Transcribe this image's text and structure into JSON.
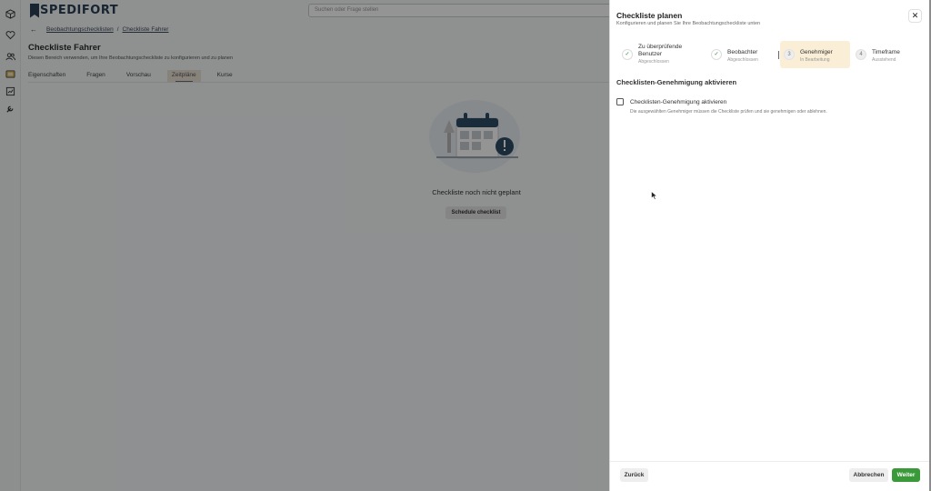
{
  "brand": {
    "name": "SPEDIFORT"
  },
  "search": {
    "placeholder": "Suchen oder Frage stellen"
  },
  "rail": {
    "icons": [
      "cube-icon",
      "heart-icon",
      "users-icon",
      "folder-icon",
      "chart-icon",
      "wrench-icon"
    ]
  },
  "breadcrumb": {
    "parent": "Beobachtungschecklisten",
    "separator": "/",
    "current": "Checkliste Fahrer"
  },
  "page": {
    "title": "Checkliste Fahrer",
    "subtitle": "Diesen Bereich verwenden, um Ihre Beobachtungscheckliste zu konfigurieren und zu planen"
  },
  "tabs": [
    {
      "label": "Eigenschaften",
      "active": false
    },
    {
      "label": "Fragen",
      "active": false
    },
    {
      "label": "Vorschau",
      "active": false
    },
    {
      "label": "Zeitpläne",
      "active": true
    },
    {
      "label": "Kurse",
      "active": false
    }
  ],
  "empty_state": {
    "title": "Checkliste noch nicht geplant",
    "button": "Schedule checklist"
  },
  "drawer": {
    "title": "Checkliste planen",
    "subtitle": "Konfigurieren und planen Sie Ihre Beobachtungscheckliste unten",
    "steps": [
      {
        "label": "Zu überprüfende Benutzer",
        "status": "Abgeschlossen",
        "marker": "✓"
      },
      {
        "label": "Beobachter",
        "status": "Abgeschlossen",
        "marker": "✓"
      },
      {
        "label": "Genehmiger",
        "status": "In Bearbeitung",
        "marker": "3"
      },
      {
        "label": "Timeframe",
        "status": "Ausstehend",
        "marker": "4"
      }
    ],
    "section_title": "Checklisten-Genehmigung aktivieren",
    "checkbox_label": "Checklisten-Genehmigung aktivieren",
    "checkbox_checked": false,
    "checkbox_description": "Die ausgewählten Genehmiger müssen die Checkliste prüfen und sie genehmigen oder ablehnen.",
    "back_button": "Zurück",
    "cancel_button": "Abbrechen",
    "next_button": "Weiter"
  },
  "colors": {
    "brand": "#2a3f55",
    "primary_button": "#3a9a3a",
    "active_step_bg": "#fbeed6",
    "overlay": "rgba(0,0,0,0.42)"
  }
}
